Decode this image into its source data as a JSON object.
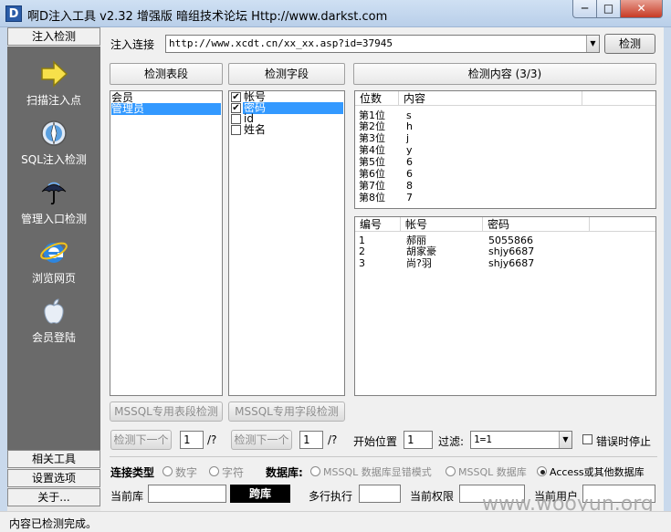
{
  "window": {
    "title": "啊D注入工具 v2.32 增强版 暗组技术论坛 Http://www.darkst.com",
    "icon_letter": "D",
    "min": "─",
    "max": "□",
    "close": "✕"
  },
  "sidebar": {
    "top_tab": "注入检测",
    "items": [
      {
        "label": "扫描注入点",
        "icon": "arrow-right-icon"
      },
      {
        "label": "SQL注入检测",
        "icon": "compass-icon"
      },
      {
        "label": "管理入口检测",
        "icon": "umbrella-icon"
      },
      {
        "label": "浏览网页",
        "icon": "ie-browser-icon"
      },
      {
        "label": "会员登陆",
        "icon": "apple-icon"
      }
    ],
    "bottom_tabs": [
      "相关工具",
      "设置选项",
      "关于..."
    ]
  },
  "url_bar": {
    "label": "注入连接",
    "value": "http://www.xcdt.cn/xx_xx.asp?id=37945",
    "detect_button": "检测"
  },
  "tables_panel": {
    "header": "检测表段",
    "items": [
      "会员",
      "管理员"
    ],
    "selected_index": 1,
    "mssql_button": "MSSQL专用表段检测"
  },
  "fields_panel": {
    "header": "检测字段",
    "items": [
      {
        "label": "帐号",
        "checked": true
      },
      {
        "label": "密码",
        "checked": true
      },
      {
        "label": "id",
        "checked": false
      },
      {
        "label": "姓名",
        "checked": false
      }
    ],
    "selected_index": 1,
    "mssql_button": "MSSQL专用字段检测"
  },
  "content_panel": {
    "header": "检测内容 (3/3)",
    "pos_columns": [
      "位数",
      "内容"
    ],
    "pos_rows": [
      [
        "第1位",
        "s"
      ],
      [
        "第2位",
        "h"
      ],
      [
        "第3位",
        "j"
      ],
      [
        "第4位",
        "y"
      ],
      [
        "第5位",
        "6"
      ],
      [
        "第6位",
        "6"
      ],
      [
        "第7位",
        "8"
      ],
      [
        "第8位",
        "7"
      ]
    ],
    "result_columns": [
      "编号",
      "帐号",
      "密码"
    ],
    "result_rows": [
      [
        "1",
        "郝丽",
        "5055866"
      ],
      [
        "2",
        "胡家豪",
        "shjy6687"
      ],
      [
        "3",
        "尚?羽",
        "shjy6687"
      ]
    ]
  },
  "nav_controls": {
    "next_table_button": "检测下一个",
    "table_index": "1",
    "table_total": "/?",
    "next_field_button": "检测下一个",
    "field_index": "1",
    "field_total": "/?",
    "start_pos_label": "开始位置",
    "start_pos_value": "1",
    "filter_label": "过滤:",
    "filter_value": "1=1",
    "stop_on_error_label": "错误时停止"
  },
  "connection": {
    "type_label": "连接类型",
    "type_options": [
      "数字",
      "字符"
    ],
    "db_label": "数据库:",
    "db_options": [
      "MSSQL 数据库显错模式",
      "MSSQL 数据库",
      "Access或其他数据库"
    ],
    "db_selected": 2
  },
  "info_row": {
    "current_db_label": "当前库",
    "current_db_value": "",
    "drop_db_button": "跨库",
    "multi_exec_label": "多行执行",
    "multi_exec_value": "",
    "current_perm_label": "当前权限",
    "current_perm_value": "",
    "current_user_label": "当前用户",
    "current_user_value": ""
  },
  "status": {
    "text": "内容已检测完成。"
  },
  "watermark": "www.wooyun.org",
  "colors": {
    "selection": "#3399ff",
    "sidebar_bg": "#6a6a6a",
    "window_frame": "#c9d9ec",
    "close_red": "#c73a24"
  }
}
